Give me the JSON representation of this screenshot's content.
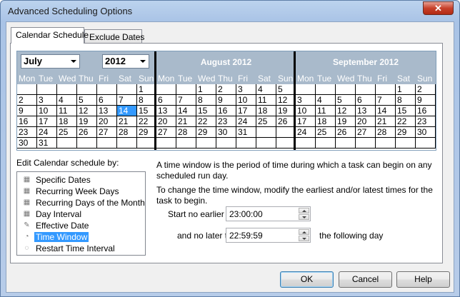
{
  "window": {
    "title": "Advanced Scheduling Options",
    "close_glyph": "✕"
  },
  "tabs": [
    {
      "label": "Calendar Schedule"
    },
    {
      "label": "Exclude Dates"
    }
  ],
  "calendar": {
    "month_select": "July",
    "year_select": "2012",
    "months": [
      {
        "title": "July 2012"
      },
      {
        "title": "August 2012"
      },
      {
        "title": "September 2012"
      }
    ],
    "weekdays": [
      "Mon",
      "Tue",
      "Wed",
      "Thu",
      "Fri",
      "Sat",
      "Sun"
    ],
    "selected_day": "14"
  },
  "edit_label": "Edit Calendar schedule by:",
  "schedule_options": [
    {
      "label": "Specific Dates",
      "icon": "calendar-dates-icon"
    },
    {
      "label": "Recurring Week Days",
      "icon": "recurring-week-icon"
    },
    {
      "label": "Recurring Days of the Month",
      "icon": "recurring-month-icon"
    },
    {
      "label": "Day Interval",
      "icon": "day-interval-icon"
    },
    {
      "label": "Effective Date",
      "icon": "effective-date-icon"
    },
    {
      "label": "Time Window",
      "icon": "clock-icon",
      "selected": true
    },
    {
      "label": "Restart Time Interval",
      "icon": "restart-icon"
    }
  ],
  "description_1": "A time window is the period of time during which a task can begin on any scheduled run day.",
  "description_2": "To change the time window, modify the earliest and/or latest times for the task to begin.",
  "start_label": "Start no earlier than",
  "start_value": "23:00:00",
  "end_label": "and no later than",
  "end_value": "22:59:59",
  "end_suffix": "the following day",
  "buttons": {
    "ok": "OK",
    "cancel": "Cancel",
    "help": "Help"
  }
}
